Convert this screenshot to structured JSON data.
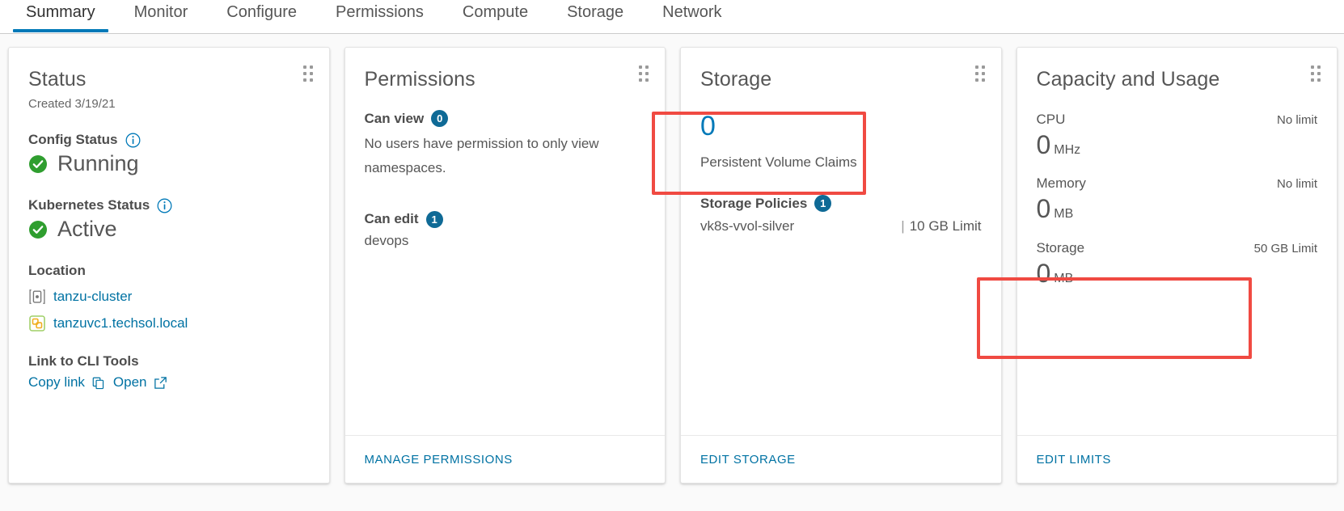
{
  "tabs": [
    {
      "label": "Summary",
      "active": true
    },
    {
      "label": "Monitor",
      "active": false
    },
    {
      "label": "Configure",
      "active": false
    },
    {
      "label": "Permissions",
      "active": false
    },
    {
      "label": "Compute",
      "active": false
    },
    {
      "label": "Storage",
      "active": false
    },
    {
      "label": "Network",
      "active": false
    }
  ],
  "colors": {
    "accent": "#0079b8",
    "link": "#0072a3",
    "badge": "#0f6a96",
    "ok": "#2f9e2f",
    "highlight": "#f04a42"
  },
  "status_card": {
    "title": "Status",
    "created": "Created 3/19/21",
    "config_status_label": "Config Status",
    "config_status_value": "Running",
    "kubernetes_status_label": "Kubernetes Status",
    "kubernetes_status_value": "Active",
    "location_label": "Location",
    "location_cluster": "tanzu-cluster",
    "location_vcenter": "tanzuvc1.techsol.local",
    "cli_label": "Link to CLI Tools",
    "cli_copy": "Copy link",
    "cli_open": "Open"
  },
  "permissions_card": {
    "title": "Permissions",
    "can_view_label": "Can view",
    "can_view_count": "0",
    "can_view_text": "No users have permission to only view namespaces.",
    "can_edit_label": "Can edit",
    "can_edit_count": "1",
    "can_edit_user": "devops",
    "action": "MANAGE PERMISSIONS"
  },
  "storage_card": {
    "title": "Storage",
    "pvc_count": "0",
    "pvc_label": "Persistent Volume Claims",
    "policies_label": "Storage Policies",
    "policies_count": "1",
    "policy_name": "vk8s-vvol-silver",
    "policy_limit": "10 GB Limit",
    "action": "EDIT STORAGE"
  },
  "capacity_card": {
    "title": "Capacity and Usage",
    "rows": [
      {
        "label": "CPU",
        "limit": "No limit",
        "value": "0",
        "unit": "MHz"
      },
      {
        "label": "Memory",
        "limit": "No limit",
        "value": "0",
        "unit": "MB"
      },
      {
        "label": "Storage",
        "limit": "50 GB Limit",
        "value": "0",
        "unit": "MB"
      }
    ],
    "action": "EDIT LIMITS"
  },
  "icons": {
    "drag_handle": "drag-handle-icon",
    "info": "info-circle-icon",
    "check": "check-circle-icon",
    "cluster": "cluster-icon",
    "vcenter": "vcenter-icon",
    "copy": "copy-icon",
    "open": "external-link-icon"
  }
}
